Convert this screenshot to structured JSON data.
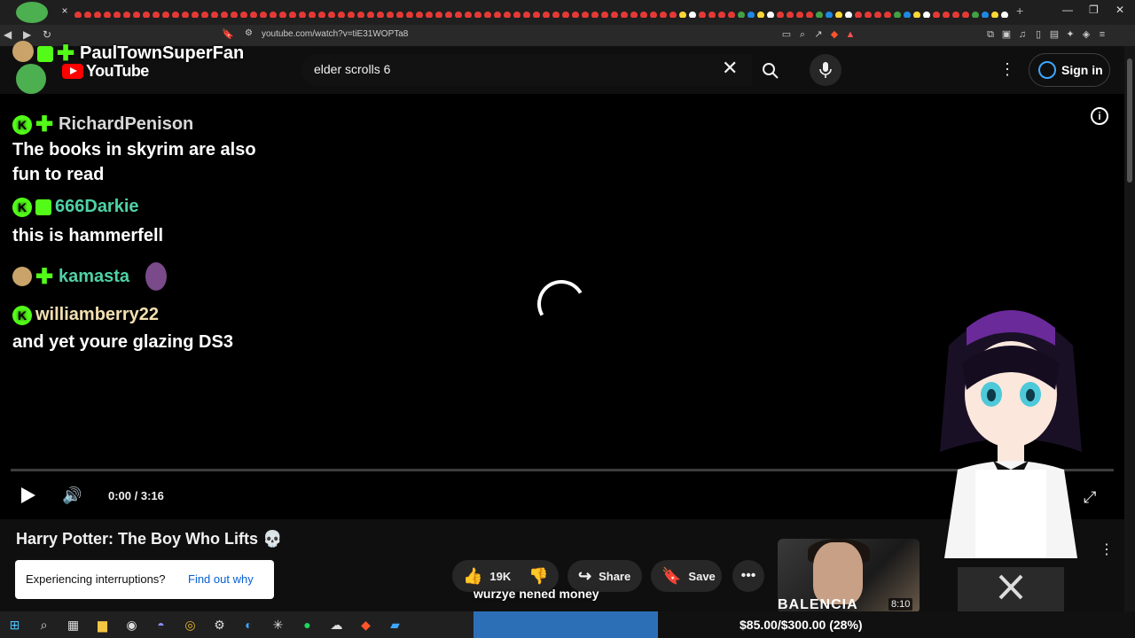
{
  "browser": {
    "url": "youtube.com/watch?v=tiE31WOPTa8",
    "new_tab_label": "+",
    "tab_close": "×",
    "window_controls": [
      "—",
      "❐",
      "✕"
    ]
  },
  "youtube": {
    "logo_text": "YouTube",
    "search_value": "elder scrolls 6",
    "sign_in_label": "Sign in"
  },
  "player": {
    "time_display": "0:00 / 3:16",
    "info_glyph": "i"
  },
  "chat": {
    "header_user": "PaulTownSuperFan",
    "messages": [
      {
        "user": "RichardPenison",
        "user_color": "#d8d8d8",
        "text": "The books in skyrim are also fun to read"
      },
      {
        "user": "666Darkie",
        "user_color": "#4fd1a5",
        "text": "this is hammerfell"
      },
      {
        "user": "kamasta",
        "user_color": "#4fd1a5",
        "text": ""
      },
      {
        "user": "williamberry22",
        "user_color": "#f3e0b0",
        "text": "and yet youre glazing DS3"
      }
    ]
  },
  "video": {
    "title": "Harry Potter: The Boy Who Lifts 💀",
    "likes": "19K",
    "share_label": "Share",
    "save_label": "Save",
    "notice_text": "Experiencing interruptions?",
    "notice_link": "Find out why",
    "recommended_thumb_text": "BALENCIA",
    "recommended_duration": "8:10"
  },
  "overlay": {
    "caption": "wurzye nened money",
    "donation_text": "$85.00/$300.00 (28%)",
    "donation_fraction": 0.28
  },
  "colors": {
    "accent": "#3ea6ff",
    "kick_green": "#53fc18",
    "donation_blue": "#2d6fb7"
  }
}
